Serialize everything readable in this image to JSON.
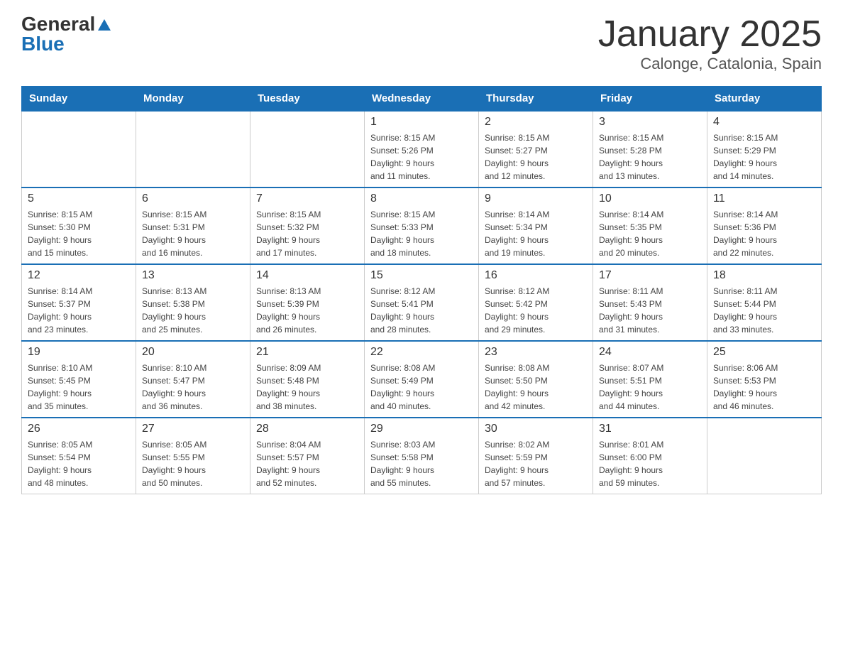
{
  "header": {
    "logo_general": "General",
    "logo_blue": "Blue",
    "title": "January 2025",
    "subtitle": "Calonge, Catalonia, Spain"
  },
  "days_of_week": [
    "Sunday",
    "Monday",
    "Tuesday",
    "Wednesday",
    "Thursday",
    "Friday",
    "Saturday"
  ],
  "weeks": [
    [
      {
        "day": "",
        "info": ""
      },
      {
        "day": "",
        "info": ""
      },
      {
        "day": "",
        "info": ""
      },
      {
        "day": "1",
        "info": "Sunrise: 8:15 AM\nSunset: 5:26 PM\nDaylight: 9 hours\nand 11 minutes."
      },
      {
        "day": "2",
        "info": "Sunrise: 8:15 AM\nSunset: 5:27 PM\nDaylight: 9 hours\nand 12 minutes."
      },
      {
        "day": "3",
        "info": "Sunrise: 8:15 AM\nSunset: 5:28 PM\nDaylight: 9 hours\nand 13 minutes."
      },
      {
        "day": "4",
        "info": "Sunrise: 8:15 AM\nSunset: 5:29 PM\nDaylight: 9 hours\nand 14 minutes."
      }
    ],
    [
      {
        "day": "5",
        "info": "Sunrise: 8:15 AM\nSunset: 5:30 PM\nDaylight: 9 hours\nand 15 minutes."
      },
      {
        "day": "6",
        "info": "Sunrise: 8:15 AM\nSunset: 5:31 PM\nDaylight: 9 hours\nand 16 minutes."
      },
      {
        "day": "7",
        "info": "Sunrise: 8:15 AM\nSunset: 5:32 PM\nDaylight: 9 hours\nand 17 minutes."
      },
      {
        "day": "8",
        "info": "Sunrise: 8:15 AM\nSunset: 5:33 PM\nDaylight: 9 hours\nand 18 minutes."
      },
      {
        "day": "9",
        "info": "Sunrise: 8:14 AM\nSunset: 5:34 PM\nDaylight: 9 hours\nand 19 minutes."
      },
      {
        "day": "10",
        "info": "Sunrise: 8:14 AM\nSunset: 5:35 PM\nDaylight: 9 hours\nand 20 minutes."
      },
      {
        "day": "11",
        "info": "Sunrise: 8:14 AM\nSunset: 5:36 PM\nDaylight: 9 hours\nand 22 minutes."
      }
    ],
    [
      {
        "day": "12",
        "info": "Sunrise: 8:14 AM\nSunset: 5:37 PM\nDaylight: 9 hours\nand 23 minutes."
      },
      {
        "day": "13",
        "info": "Sunrise: 8:13 AM\nSunset: 5:38 PM\nDaylight: 9 hours\nand 25 minutes."
      },
      {
        "day": "14",
        "info": "Sunrise: 8:13 AM\nSunset: 5:39 PM\nDaylight: 9 hours\nand 26 minutes."
      },
      {
        "day": "15",
        "info": "Sunrise: 8:12 AM\nSunset: 5:41 PM\nDaylight: 9 hours\nand 28 minutes."
      },
      {
        "day": "16",
        "info": "Sunrise: 8:12 AM\nSunset: 5:42 PM\nDaylight: 9 hours\nand 29 minutes."
      },
      {
        "day": "17",
        "info": "Sunrise: 8:11 AM\nSunset: 5:43 PM\nDaylight: 9 hours\nand 31 minutes."
      },
      {
        "day": "18",
        "info": "Sunrise: 8:11 AM\nSunset: 5:44 PM\nDaylight: 9 hours\nand 33 minutes."
      }
    ],
    [
      {
        "day": "19",
        "info": "Sunrise: 8:10 AM\nSunset: 5:45 PM\nDaylight: 9 hours\nand 35 minutes."
      },
      {
        "day": "20",
        "info": "Sunrise: 8:10 AM\nSunset: 5:47 PM\nDaylight: 9 hours\nand 36 minutes."
      },
      {
        "day": "21",
        "info": "Sunrise: 8:09 AM\nSunset: 5:48 PM\nDaylight: 9 hours\nand 38 minutes."
      },
      {
        "day": "22",
        "info": "Sunrise: 8:08 AM\nSunset: 5:49 PM\nDaylight: 9 hours\nand 40 minutes."
      },
      {
        "day": "23",
        "info": "Sunrise: 8:08 AM\nSunset: 5:50 PM\nDaylight: 9 hours\nand 42 minutes."
      },
      {
        "day": "24",
        "info": "Sunrise: 8:07 AM\nSunset: 5:51 PM\nDaylight: 9 hours\nand 44 minutes."
      },
      {
        "day": "25",
        "info": "Sunrise: 8:06 AM\nSunset: 5:53 PM\nDaylight: 9 hours\nand 46 minutes."
      }
    ],
    [
      {
        "day": "26",
        "info": "Sunrise: 8:05 AM\nSunset: 5:54 PM\nDaylight: 9 hours\nand 48 minutes."
      },
      {
        "day": "27",
        "info": "Sunrise: 8:05 AM\nSunset: 5:55 PM\nDaylight: 9 hours\nand 50 minutes."
      },
      {
        "day": "28",
        "info": "Sunrise: 8:04 AM\nSunset: 5:57 PM\nDaylight: 9 hours\nand 52 minutes."
      },
      {
        "day": "29",
        "info": "Sunrise: 8:03 AM\nSunset: 5:58 PM\nDaylight: 9 hours\nand 55 minutes."
      },
      {
        "day": "30",
        "info": "Sunrise: 8:02 AM\nSunset: 5:59 PM\nDaylight: 9 hours\nand 57 minutes."
      },
      {
        "day": "31",
        "info": "Sunrise: 8:01 AM\nSunset: 6:00 PM\nDaylight: 9 hours\nand 59 minutes."
      },
      {
        "day": "",
        "info": ""
      }
    ]
  ]
}
